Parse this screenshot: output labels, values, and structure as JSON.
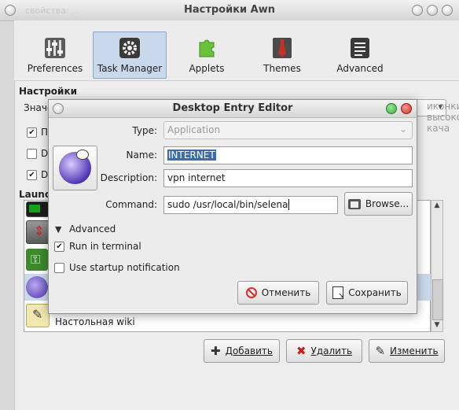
{
  "main_window": {
    "title": "Настройки Awn",
    "subtitle": "свойства: ...",
    "toolbar": [
      {
        "label": "Preferences",
        "icon": "preferences-sliders-icon"
      },
      {
        "label": "Task Manager",
        "icon": "task-manager-gear-icon",
        "active": true
      },
      {
        "label": "Applets",
        "icon": "applets-puzzle-icon"
      },
      {
        "label": "Themes",
        "icon": "themes-necktie-icon"
      },
      {
        "label": "Advanced",
        "icon": "advanced-list-icon"
      }
    ],
    "settings_heading": "Настройки",
    "value_label": "Значе",
    "value_combo": "иконки высокого кача",
    "checkbox_1": {
      "label": "П",
      "checked": true
    },
    "checkbox_2": {
      "label": "D",
      "checked": false
    },
    "checkbox_3": {
      "label": "D",
      "checked": true
    },
    "launchers_heading": "Launc",
    "list_last_item": "Настольная wiki",
    "buttons": {
      "add": "Добавить",
      "delete": "Удалить",
      "edit": "Изменить"
    }
  },
  "dialog": {
    "title": "Desktop Entry Editor",
    "type_label": "Type:",
    "type_value": "Application",
    "name_label": "Name:",
    "name_value": "INTERNET",
    "description_label": "Description:",
    "description_value": "vpn internet",
    "command_label": "Command:",
    "command_value": "sudo /usr/local/bin/selena",
    "browse_label": "Browse...",
    "advanced_label": "Advanced",
    "run_in_terminal_label": "Run in terminal",
    "run_in_terminal_checked": true,
    "startup_notification_label": "Use startup notification",
    "startup_notification_checked": false,
    "cancel_label": "Отменить",
    "save_label": "Сохранить"
  },
  "colors": {
    "selection": "#3b6ea8",
    "active_tab": "#c9d8ea",
    "close_red": "#d9302b",
    "max_green": "#3cae3c"
  }
}
